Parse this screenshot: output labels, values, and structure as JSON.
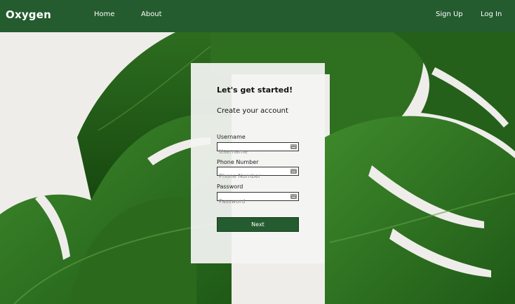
{
  "navbar": {
    "brand": "Oxygen",
    "links": {
      "home": "Home",
      "about": "About",
      "sign_up": "Sign Up",
      "log_in": "Log In"
    }
  },
  "signup_card": {
    "title": "Let's get started!",
    "subtitle": "Create your account",
    "fields": {
      "username": {
        "label": "Username",
        "placeholder": "Username",
        "value": ""
      },
      "phone": {
        "label": "Phone Number",
        "placeholder": "Phone Number",
        "value": ""
      },
      "password": {
        "label": "Password",
        "placeholder": "Password",
        "value": ""
      }
    },
    "next_label": "Next"
  },
  "colors": {
    "nav_background": "#245b2f",
    "button_background": "#245b2f",
    "card_background": "#f4f4f3",
    "leaf_green": "#2e6b21"
  },
  "icons": {
    "field_icon": "password-manager-key-icon"
  }
}
